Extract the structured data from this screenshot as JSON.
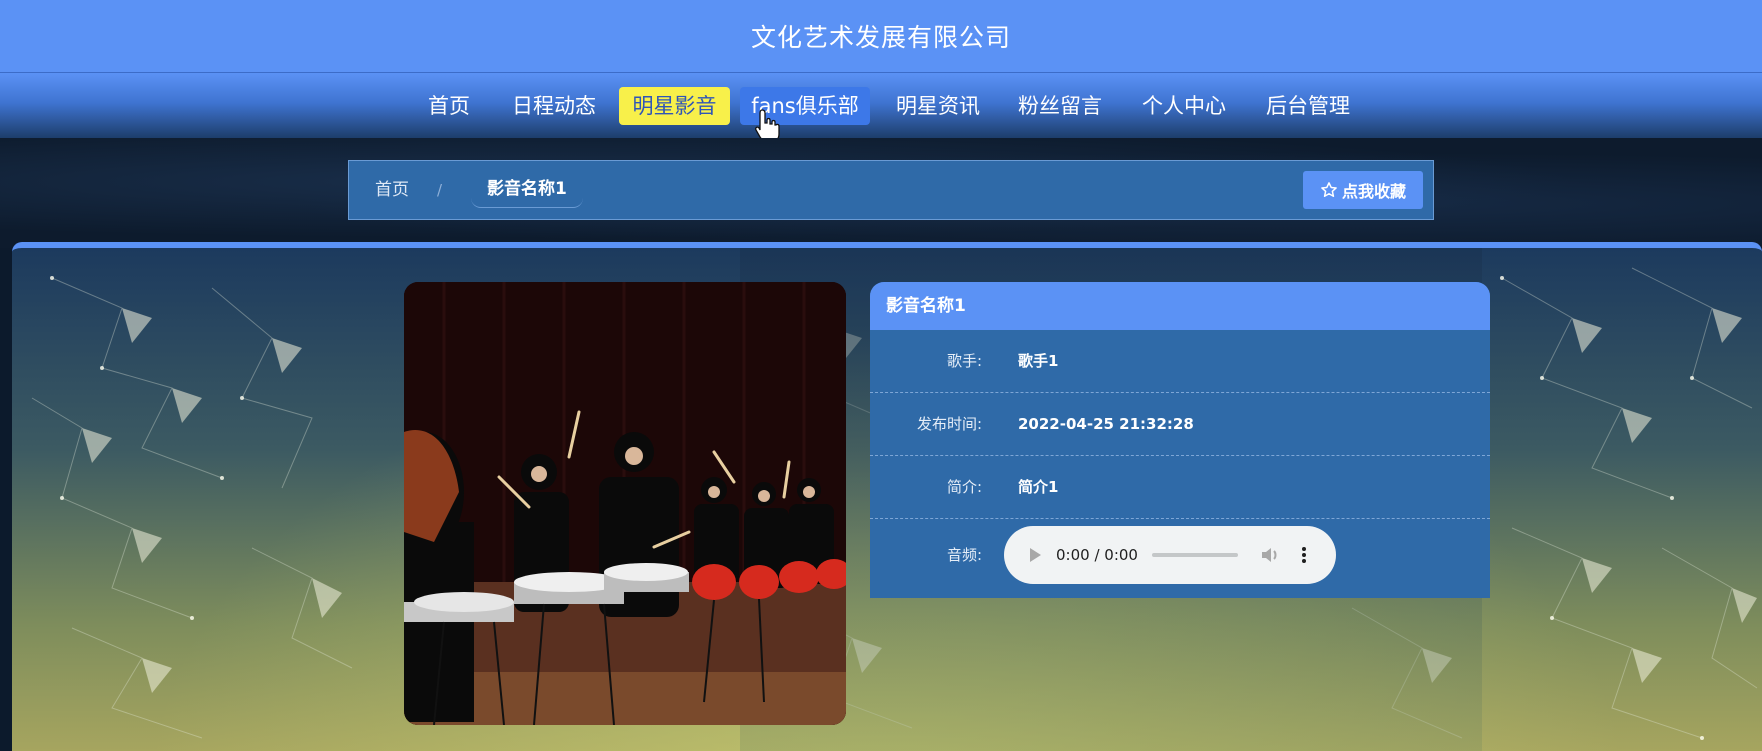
{
  "site": {
    "title": "文化艺术发展有限公司"
  },
  "nav": {
    "items": [
      {
        "label": "首页",
        "state": "normal"
      },
      {
        "label": "日程动态",
        "state": "normal"
      },
      {
        "label": "明星影音",
        "state": "active"
      },
      {
        "label": "fans俱乐部",
        "state": "hover"
      },
      {
        "label": "明星资讯",
        "state": "normal"
      },
      {
        "label": "粉丝留言",
        "state": "normal"
      },
      {
        "label": "个人中心",
        "state": "normal"
      },
      {
        "label": "后台管理",
        "state": "normal"
      }
    ]
  },
  "breadcrumb": {
    "home": "首页",
    "separator": "/",
    "current": "影音名称1",
    "favorite_label": "点我收藏",
    "favorite_icon": "star-outline-icon"
  },
  "detail": {
    "title": "影音名称1",
    "rows": [
      {
        "label": "歌手:",
        "value": "歌手1"
      },
      {
        "label": "发布时间:",
        "value": "2022-04-25 21:32:28"
      },
      {
        "label": "简介:",
        "value": "简介1"
      }
    ],
    "audio": {
      "label": "音频:",
      "time": "0:00 / 0:00"
    }
  },
  "colors": {
    "header": "#5b92f5",
    "active_nav": "#f8f04a",
    "card": "#2f6aa8",
    "player": "#f1f3f4"
  }
}
